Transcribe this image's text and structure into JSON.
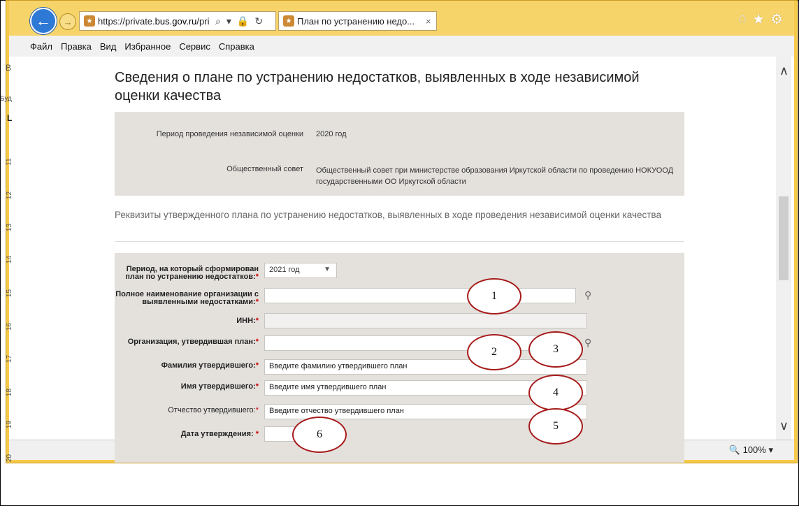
{
  "browser": {
    "url_prefix": "https://private.",
    "url_domain": "bus.gov.ru",
    "url_suffix": "/priv",
    "tab_title": "План по устранению недо...",
    "tab_close": "×",
    "back_icon": "←",
    "fwd_icon": "→",
    "home_icon": "⌂",
    "star_icon": "★",
    "gear_icon": "⚙",
    "search_glyph": "⌕",
    "dropdown_glyph": "▾",
    "lock_glyph": "🔒",
    "refresh_glyph": "↻",
    "menu": [
      "Файл",
      "Правка",
      "Вид",
      "Избранное",
      "Сервис",
      "Справка"
    ],
    "zoom": "100%",
    "zoom_arrow": "▾",
    "zoom_icon": "🔍"
  },
  "side": {
    "letter_b": "В",
    "text_bu": "Буд",
    "letter_l": "L",
    "ruler_numbers": [
      "11",
      "12",
      "13",
      "14",
      "15",
      "16",
      "17",
      "18",
      "19",
      "20"
    ]
  },
  "page": {
    "title": "Сведения о плане по устранению недостатков, выявленных в ходе независимой оценки качества",
    "info": {
      "period_label": "Период проведения независимой оценки",
      "period_value": "2020  год",
      "council_label": "Общественный совет",
      "council_value": "Общественный совет при министерстве образования Иркутской области по проведению НОКУООД государственными ОО Иркутской области"
    },
    "requisites_title": "Реквизиты утвержденного плана по устранению недостатков, выявленных в ходе проведения независимой оценки качества",
    "form": {
      "period_label": "Период, на который сформирован план по устранению недостатков:",
      "period_value": "2021 год",
      "org_name_label": "Полное наименование организации с выявленными недостатками:",
      "org_name_value": "",
      "inn_label": "ИНН:",
      "inn_value": "",
      "approver_org_label": "Организация, утвердившая план:",
      "approver_org_value": "",
      "surname_label": "Фамилия утвердившего:",
      "surname_placeholder": "Введите фамилию утвердившего план",
      "name_label": "Имя утвердившего:",
      "name_placeholder": "Введите имя утвердившего план",
      "patronymic_label": "Отчество утвердившего:",
      "patronymic_placeholder": "Введите отчество утвердившего план",
      "date_label": "Дата утверждения:",
      "date_value": "",
      "required_mark": "*"
    }
  },
  "annotations": [
    "1",
    "2",
    "3",
    "4",
    "5",
    "6"
  ],
  "colors": {
    "window_frame": "#f5c94a",
    "back_button": "#2f79d6",
    "form_bg": "#e4e1dd",
    "required": "#cc0000",
    "annotation_circle": "#a71c1c"
  }
}
